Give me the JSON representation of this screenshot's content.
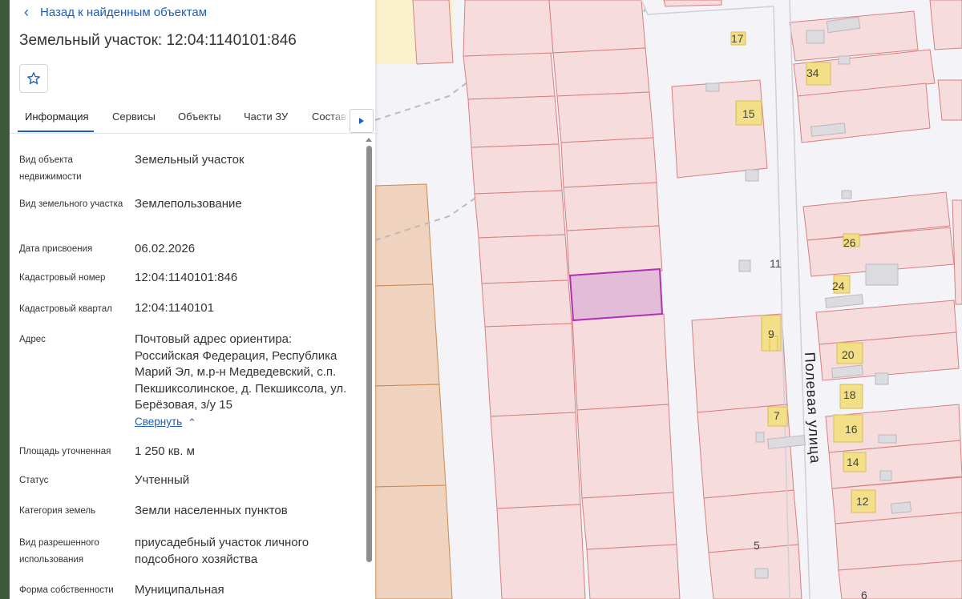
{
  "back_link": "Назад к найденным объектам",
  "title": "Земельный участок: 12:04:1140101:846",
  "tabs": [
    "Информация",
    "Сервисы",
    "Объекты",
    "Части ЗУ",
    "Состав"
  ],
  "info": {
    "object_type": {
      "label": "Вид объекта недвижимости",
      "value": "Земельный участок"
    },
    "land_type": {
      "label": "Вид земельного участка",
      "value": "Землепользование"
    },
    "date": {
      "label": "Дата присвоения",
      "value": "06.02.2026"
    },
    "cad_number": {
      "label": "Кадастровый номер",
      "value": "12:04:1140101:846"
    },
    "cad_block": {
      "label": "Кадастровый квартал",
      "value": "12:04:1140101"
    },
    "address": {
      "label": "Адрес",
      "value": "Почтовый адрес ориентира: Российская Федерация, Республика Марий Эл, м.р-н Медведевский, с.п. Пекшиксолинское, д. Пекшиксола, ул. Берёзовая, з/у 15"
    },
    "collapse": "Свернуть",
    "area": {
      "label": "Площадь уточненная",
      "value": "1 250 кв. м"
    },
    "status": {
      "label": "Статус",
      "value": "Учтенный"
    },
    "category": {
      "label": "Категория земель",
      "value": "Земли населенных пунктов"
    },
    "permitted_use": {
      "label": "Вид разрешенного использования",
      "value": "приусадебный участок личного подсобного хозяйства"
    },
    "ownership": {
      "label": "Форма собственности",
      "value": "Муниципальная"
    }
  },
  "map": {
    "street_name": "Полевая улица",
    "house_numbers": [
      "17",
      "34",
      "15",
      "11",
      "26",
      "24",
      "9",
      "20",
      "18",
      "7",
      "16",
      "14",
      "12",
      "5",
      "6"
    ],
    "highlight_color": "#b12fb3",
    "parcel_fill": "#f6dcdc",
    "parcel_stroke": "#d68080"
  },
  "icons": {
    "back": "chevron-left-icon",
    "star": "star-outline-icon",
    "tab_scroll": "caret-right-icon"
  }
}
